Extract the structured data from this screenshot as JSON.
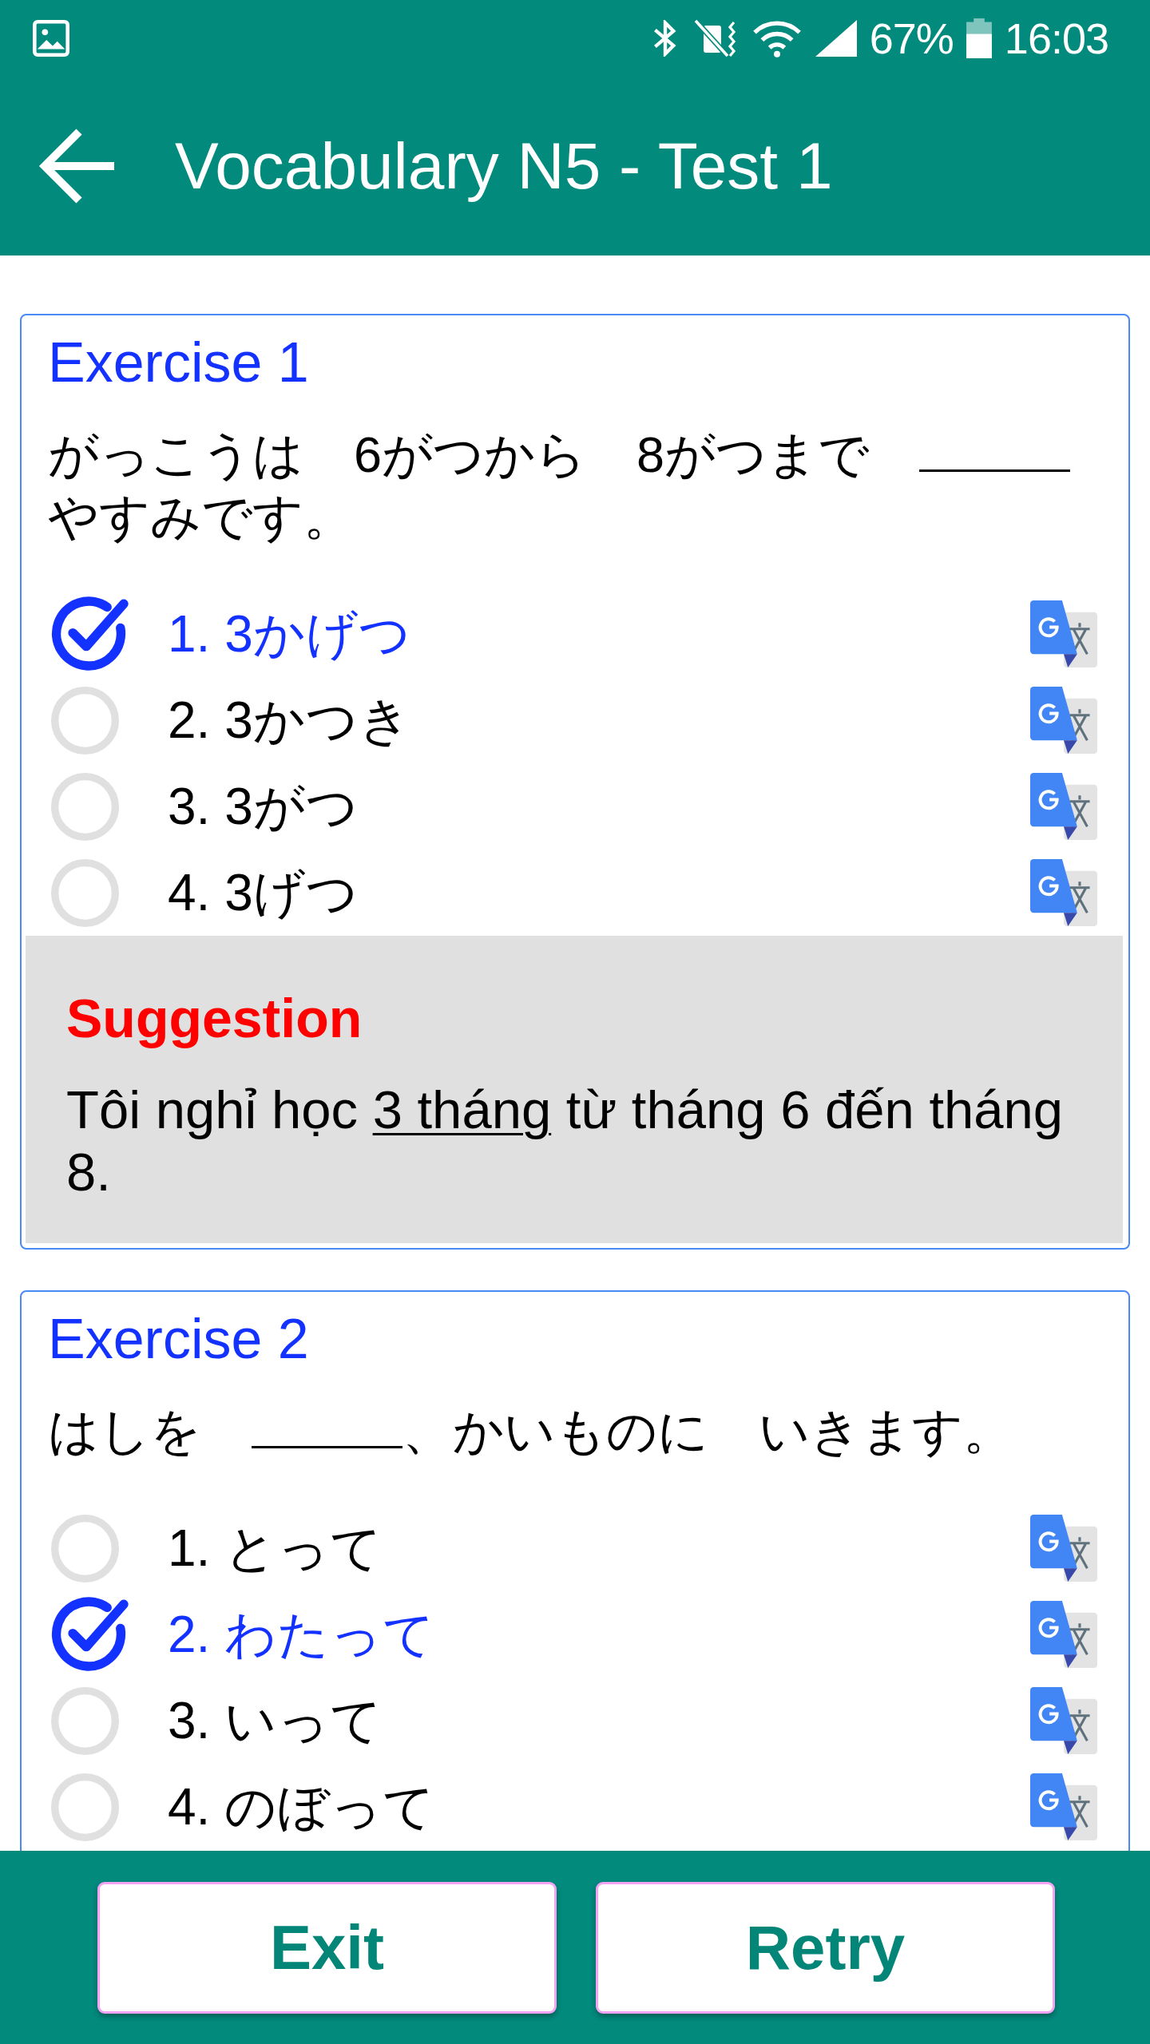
{
  "status_bar": {
    "battery": "67%",
    "time": "16:03"
  },
  "app_bar": {
    "title": "Vocabulary N5 - Test 1"
  },
  "exercises": [
    {
      "title": "Exercise 1",
      "question": [
        {
          "kind": "text",
          "text": "がっこうは　6がつから　8がつまで　"
        },
        {
          "kind": "blank"
        },
        {
          "kind": "text",
          "text": "　やすみです。"
        }
      ],
      "options": [
        {
          "label": "1. 3かげつ",
          "selected": true
        },
        {
          "label": "2. 3かつき",
          "selected": false
        },
        {
          "label": "3. 3がつ",
          "selected": false
        },
        {
          "label": "4. 3げつ",
          "selected": false
        }
      ],
      "suggestion": {
        "heading": "Suggestion",
        "text": [
          {
            "text": "Tôi nghỉ học ",
            "underline": false
          },
          {
            "text": "3 tháng",
            "underline": true
          },
          {
            "text": " từ tháng 6 đến tháng 8.",
            "underline": false
          }
        ]
      }
    },
    {
      "title": "Exercise 2",
      "question": [
        {
          "kind": "text",
          "text": "はしを　"
        },
        {
          "kind": "blank"
        },
        {
          "kind": "text",
          "text": "、かいものに　いきます。"
        }
      ],
      "options": [
        {
          "label": "1. とって",
          "selected": false
        },
        {
          "label": "2. わたって",
          "selected": true
        },
        {
          "label": "3. いって",
          "selected": false
        },
        {
          "label": "4. のぼって",
          "selected": false
        }
      ]
    }
  ],
  "buttons": [
    {
      "label": "Exit"
    },
    {
      "label": "Retry"
    }
  ]
}
